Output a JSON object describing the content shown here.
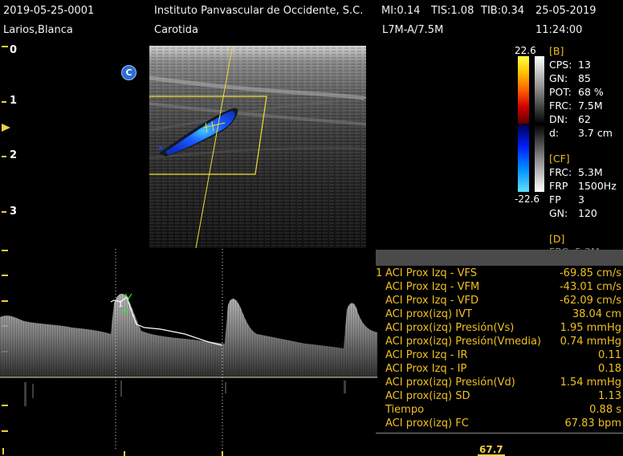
{
  "header": {
    "exam_id": "2019-05-25-0001",
    "institution": "Instituto Panvascular de Occidente, S.C.",
    "mi": "MI:0.14",
    "tis": "TIS:1.08",
    "tib": "TIB:0.34",
    "date": "25-05-2019",
    "patient": "Larios,Blanca",
    "study": "Carotida",
    "probe": "L7M-A/7.5M",
    "time": "11:24:00"
  },
  "depth_scale": [
    "0",
    "1",
    "2",
    "3"
  ],
  "badge": "C",
  "color_scale": {
    "max": "22.6",
    "min": "-22.6"
  },
  "b_params": {
    "section": "[B]",
    "rows": [
      {
        "k": "CPS:",
        "v": "13"
      },
      {
        "k": "GN:",
        "v": "85"
      },
      {
        "k": "POT:",
        "v": "68 %"
      },
      {
        "k": "FRC:",
        "v": "7.5M"
      },
      {
        "k": "DN:",
        "v": "62"
      },
      {
        "k": "d:",
        "v": "3.7 cm"
      }
    ]
  },
  "cf_params": {
    "section": "[CF]",
    "rows": [
      {
        "k": "FRC:",
        "v": "5.3M"
      },
      {
        "k": "FRP",
        "v": "1500Hz"
      },
      {
        "k": "FP",
        "v": "3"
      },
      {
        "k": "GN:",
        "v": "120"
      }
    ]
  },
  "d_params": {
    "section": "[D]",
    "partial": "FRC: 5.3M"
  },
  "measurements": [
    {
      "num": "1",
      "label": "ACI Prox Izq - VFS",
      "value": "-69.85 cm/s"
    },
    {
      "num": "",
      "label": "ACI Prox Izq - VFM",
      "value": "-43.01 cm/s"
    },
    {
      "num": "",
      "label": "ACI Prox Izq - VFD",
      "value": "-62.09 cm/s"
    },
    {
      "num": "",
      "label": "ACI prox(izq) IVT",
      "value": "38.04 cm"
    },
    {
      "num": "",
      "label": "ACI prox(izq) Presión(Vs)",
      "value": "1.95 mmHg"
    },
    {
      "num": "",
      "label": "ACI prox(izq) Presión(Vmedia)",
      "value": "0.74 mmHg"
    },
    {
      "num": "",
      "label": "ACI Prox Izq - IR",
      "value": "0.11"
    },
    {
      "num": "",
      "label": "ACI Prox Izq - IP",
      "value": "0.18"
    },
    {
      "num": "",
      "label": "ACI prox(izq) Presión(Vd)",
      "value": "1.54 mmHg"
    },
    {
      "num": "",
      "label": "ACI prox(izq) SD",
      "value": "1.13"
    },
    {
      "num": "",
      "label": "Tiempo",
      "value": "0.88 s"
    },
    {
      "num": "",
      "label": "ACI prox(izq) FC",
      "value": "67.83 bpm"
    }
  ],
  "heart_rate_display": "67.7",
  "doppler_marker_labels": {
    "peak": "1",
    "s": "S"
  },
  "colors": {
    "accent_yellow": "#f0d040",
    "text_orange": "#f0c020",
    "header_bar": "#4a4a4a"
  }
}
